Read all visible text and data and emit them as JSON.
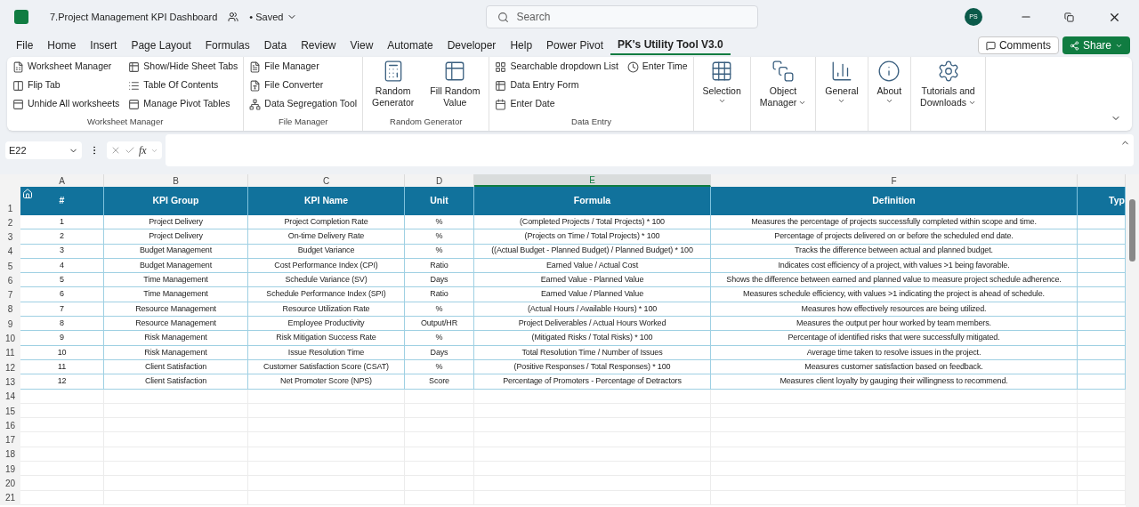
{
  "window": {
    "title": "7.Project Management KPI Dashboard",
    "save_status": "• Saved",
    "search": {
      "placeholder": "Search"
    },
    "avatar": "PS"
  },
  "menu_tabs": [
    {
      "label": "File",
      "selected": false
    },
    {
      "label": "Home",
      "selected": false
    },
    {
      "label": "Insert",
      "selected": false
    },
    {
      "label": "Page Layout",
      "selected": false
    },
    {
      "label": "Formulas",
      "selected": false
    },
    {
      "label": "Data",
      "selected": false
    },
    {
      "label": "Review",
      "selected": false
    },
    {
      "label": "View",
      "selected": false
    },
    {
      "label": "Automate",
      "selected": false
    },
    {
      "label": "Developer",
      "selected": false
    },
    {
      "label": "Help",
      "selected": false
    },
    {
      "label": "Power Pivot",
      "selected": false
    },
    {
      "label": "PK's Utility Tool V3.0",
      "selected": true
    }
  ],
  "header_buttons": {
    "comments": "Comments",
    "share": "Share"
  },
  "ribbon_groups": [
    {
      "label": "Worksheet Manager",
      "kind": "small",
      "columns": [
        [
          "Worksheet Manager",
          "Flip Tab",
          "Unhide All worksheets"
        ],
        [
          "Show/Hide Sheet Tabs",
          "Table Of Contents",
          "Manage Pivot Tables"
        ]
      ]
    },
    {
      "label": "File Manager",
      "kind": "small",
      "columns": [
        [
          "File Manager",
          "File Converter",
          "Data Segregation Tool"
        ]
      ]
    },
    {
      "label": "Random Generator",
      "kind": "large",
      "buttons": [
        {
          "lines": [
            "Random",
            "Generator"
          ],
          "dropdown": false
        },
        {
          "lines": [
            "Fill Random",
            "Value"
          ],
          "dropdown": false
        }
      ]
    },
    {
      "label": "Data Entry",
      "kind": "small",
      "columns": [
        [
          "Searchable dropdown List",
          "Data Entry Form",
          "Enter Date"
        ],
        [
          "Enter Time"
        ]
      ]
    },
    {
      "kind": "large",
      "buttons": [
        {
          "lines": [
            "Selection"
          ],
          "dropdown": true
        }
      ]
    },
    {
      "kind": "large",
      "buttons": [
        {
          "lines": [
            "Object",
            "Manager"
          ],
          "dropdown": true
        }
      ]
    },
    {
      "kind": "large",
      "buttons": [
        {
          "lines": [
            "General"
          ],
          "dropdown": true
        }
      ]
    },
    {
      "kind": "large",
      "buttons": [
        {
          "lines": [
            "About"
          ],
          "dropdown": true
        }
      ]
    },
    {
      "kind": "large",
      "buttons": [
        {
          "lines": [
            "Tutorials and",
            "Downloads"
          ],
          "dropdown": true
        }
      ]
    }
  ],
  "formula_bar": {
    "name_box": "E22",
    "fx": "fx"
  },
  "sheet": {
    "column_letters": [
      {
        "label": "A",
        "selected": false
      },
      {
        "label": "B",
        "selected": false
      },
      {
        "label": "C",
        "selected": false
      },
      {
        "label": "D",
        "selected": false
      },
      {
        "label": "E",
        "selected": true
      },
      {
        "label": "F",
        "selected": false
      }
    ],
    "header": [
      "#",
      "KPI Group",
      "KPI Name",
      "Unit",
      "Formula",
      "Definition",
      "Typ"
    ],
    "rows": [
      [
        "1",
        "Project Delivery",
        "Project Completion Rate",
        "%",
        "(Completed Projects / Total Projects) * 100",
        "Measures the percentage of projects successfully completed within scope and time."
      ],
      [
        "2",
        "Project Delivery",
        "On-time Delivery Rate",
        "%",
        "(Projects on Time / Total Projects) * 100",
        "Percentage of projects delivered on or before the scheduled end date."
      ],
      [
        "3",
        "Budget Management",
        "Budget Variance",
        "%",
        "((Actual Budget - Planned Budget) / Planned Budget) * 100",
        "Tracks the difference between actual and planned budget."
      ],
      [
        "4",
        "Budget Management",
        "Cost Performance Index (CPI)",
        "Ratio",
        "Earned Value / Actual Cost",
        "Indicates cost efficiency of a project, with values >1 being favorable."
      ],
      [
        "5",
        "Time Management",
        "Schedule Variance (SV)",
        "Days",
        "Earned Value - Planned Value",
        "Shows the difference between earned and planned value to measure project schedule adherence."
      ],
      [
        "6",
        "Time Management",
        "Schedule Performance Index (SPI)",
        "Ratio",
        "Earned Value / Planned Value",
        "Measures schedule efficiency, with values >1 indicating the project is ahead of schedule."
      ],
      [
        "7",
        "Resource Management",
        "Resource Utilization Rate",
        "%",
        "(Actual Hours / Available Hours) * 100",
        "Measures how effectively resources are being utilized."
      ],
      [
        "8",
        "Resource Management",
        "Employee Productivity",
        "Output/HR",
        "Project Deliverables / Actual Hours Worked",
        "Measures the output per hour worked by team members."
      ],
      [
        "9",
        "Risk Management",
        "Risk Mitigation Success Rate",
        "%",
        "(Mitigated Risks / Total Risks) * 100",
        "Percentage of identified risks that were successfully mitigated."
      ],
      [
        "10",
        "Risk Management",
        "Issue Resolution Time",
        "Days",
        "Total Resolution Time / Number of Issues",
        "Average time taken to resolve issues in the project."
      ],
      [
        "11",
        "Client Satisfaction",
        "Customer Satisfaction Score (CSAT)",
        "%",
        "(Positive Responses / Total Responses) * 100",
        "Measures customer satisfaction based on feedback."
      ],
      [
        "12",
        "Client Satisfaction",
        "Net Promoter Score (NPS)",
        "Score",
        "Percentage of Promoters - Percentage of Detractors",
        "Measures client loyalty by gauging their willingness to recommend."
      ]
    ],
    "row_numbers": [
      "1",
      "2",
      "3",
      "4",
      "5",
      "6",
      "7",
      "8",
      "9",
      "10",
      "11",
      "12",
      "13",
      "14",
      "15",
      "16",
      "17",
      "18",
      "19",
      "20",
      "21"
    ]
  }
}
